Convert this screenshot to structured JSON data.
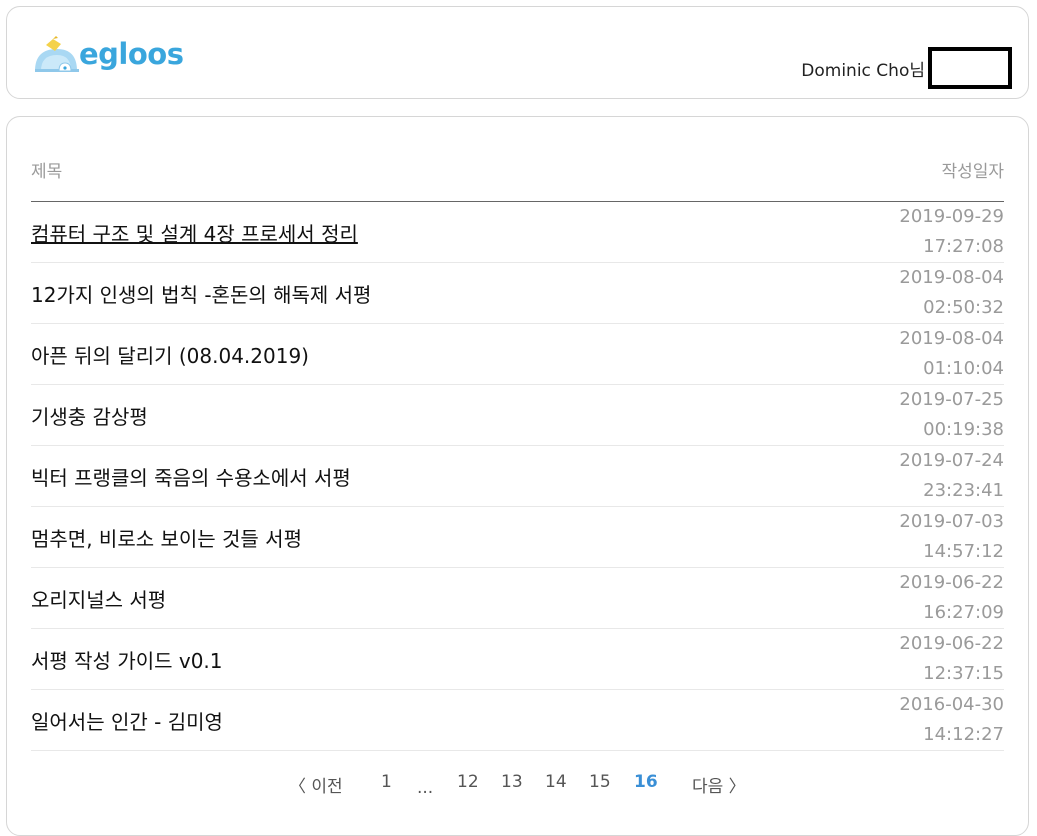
{
  "header": {
    "logo_text": "egloos",
    "user_name": "Dominic Cho님"
  },
  "list": {
    "col_title": "제목",
    "col_date": "작성일자",
    "posts": [
      {
        "title": "컴퓨터 구조 및 설계 4장 프로세서 정리",
        "date": "2019-09-29",
        "time": "17:27:08"
      },
      {
        "title": "12가지 인생의 법칙 -혼돈의 해독제 서평",
        "date": "2019-08-04",
        "time": "02:50:32"
      },
      {
        "title": "아픈 뒤의 달리기 (08.04.2019)",
        "date": "2019-08-04",
        "time": "01:10:04"
      },
      {
        "title": "기생충 감상평",
        "date": "2019-07-25",
        "time": "00:19:38"
      },
      {
        "title": "빅터 프랭클의 죽음의 수용소에서 서평",
        "date": "2019-07-24",
        "time": "23:23:41"
      },
      {
        "title": "멈추면, 비로소 보이는 것들 서평",
        "date": "2019-07-03",
        "time": "14:57:12"
      },
      {
        "title": "오리지널스 서평",
        "date": "2019-06-22",
        "time": "16:27:09"
      },
      {
        "title": "서평 작성 가이드 v0.1",
        "date": "2019-06-22",
        "time": "12:37:15"
      },
      {
        "title": "일어서는 인간 - 김미영",
        "date": "2016-04-30",
        "time": "14:12:27"
      }
    ]
  },
  "pagination": {
    "prev": "〈 이전",
    "first": "1",
    "ellipsis": "...",
    "pages": [
      "12",
      "13",
      "14",
      "15"
    ],
    "current": "16",
    "next": "다음 〉"
  },
  "colors": {
    "accent": "#3a8fd6",
    "logo": "#3aa6dd",
    "muted": "#9a9a9a"
  }
}
